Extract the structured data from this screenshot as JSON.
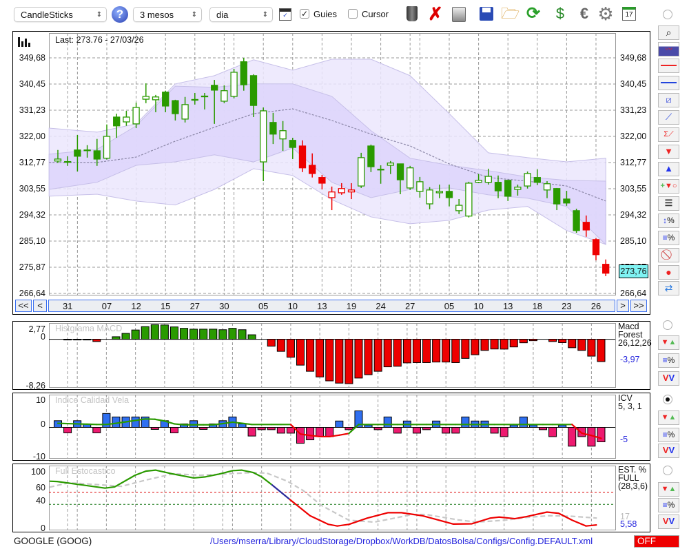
{
  "toolbar": {
    "chart_type": "CandleSticks",
    "help_label": "?",
    "period": "3 mesos",
    "interval": "dia",
    "guies_label": "Guies",
    "guies_checked": true,
    "cursor_label": "Cursor",
    "cursor_checked": false,
    "check_mark": "✓"
  },
  "colors": {
    "up": "#2a9a00",
    "red": "#ee0000",
    "band_outer": "#ebe6fd",
    "band_inner": "#ddd5fb",
    "icv_pos": "#2f6ff0",
    "icv_neg": "#ee1a70",
    "badge": "#7ff3f3",
    "off": "#ee0000",
    "path": "#2222dd"
  },
  "chart_data": {
    "type": "candlestick",
    "main": {
      "last_label": "Last: 273.76 - 27/03/26",
      "price_badge": "273,76",
      "y_tick_values": [
        349.68,
        340.45,
        331.23,
        322.0,
        312.77,
        303.55,
        294.32,
        285.1,
        275.87,
        266.64
      ],
      "y_ticks": [
        "349,68",
        "340,45",
        "331,23",
        "322,00",
        "312,77",
        "303,55",
        "294,32",
        "285,10",
        "275,87",
        "266,64"
      ],
      "ylim": [
        266.64,
        349.68
      ],
      "candles_ohlc": [
        [
          313.3,
          317.2,
          312.6,
          314.0,
          "g"
        ],
        [
          313.0,
          315.0,
          311.6,
          313.1,
          "g"
        ],
        [
          317.2,
          322.5,
          309.6,
          315.0,
          "g"
        ],
        [
          317.2,
          318.9,
          314.5,
          317.1,
          "g"
        ],
        [
          316.9,
          321.1,
          311.6,
          314.0,
          "g"
        ],
        [
          314.3,
          326.2,
          313.8,
          322.0,
          "g"
        ],
        [
          328.8,
          330.0,
          321.5,
          325.7,
          "g"
        ],
        [
          327.1,
          331.0,
          325.7,
          328.8,
          "g"
        ],
        [
          326.4,
          333.9,
          324.9,
          332.2,
          "g"
        ],
        [
          335.1,
          340.7,
          333.7,
          336.1,
          "g"
        ],
        [
          334.9,
          336.6,
          330.5,
          335.9,
          "g"
        ],
        [
          337.6,
          338.1,
          330.5,
          332.7,
          "g"
        ],
        [
          334.6,
          334.9,
          327.6,
          330.0,
          "g"
        ],
        [
          328.1,
          335.9,
          326.9,
          333.2,
          "g"
        ],
        [
          334.9,
          337.3,
          333.2,
          335.0,
          "g"
        ],
        [
          336.1,
          337.3,
          331.5,
          336.2,
          "g"
        ],
        [
          340.0,
          341.9,
          326.4,
          338.3,
          "g"
        ],
        [
          334.4,
          340.0,
          333.7,
          338.1,
          "g"
        ],
        [
          336.1,
          345.8,
          335.4,
          344.6,
          "g"
        ],
        [
          348.3,
          349.7,
          338.1,
          340.2,
          "g"
        ],
        [
          343.4,
          343.9,
          328.8,
          332.9,
          "g"
        ],
        [
          313.0,
          332.2,
          306.2,
          331.0,
          "g"
        ],
        [
          326.9,
          330.3,
          319.3,
          322.8,
          "g"
        ],
        [
          321.1,
          327.4,
          316.9,
          324.0,
          "g"
        ],
        [
          320.6,
          321.5,
          314.0,
          318.1,
          "g"
        ],
        [
          318.6,
          320.6,
          309.4,
          310.9,
          "r"
        ],
        [
          311.8,
          316.0,
          307.5,
          308.9,
          "r"
        ],
        [
          307.5,
          308.4,
          303.3,
          305.5,
          "r"
        ],
        [
          300.4,
          304.3,
          296.0,
          302.4,
          "r"
        ],
        [
          302.1,
          305.5,
          301.4,
          303.6,
          "r"
        ],
        [
          302.4,
          305.5,
          299.9,
          303.1,
          "r"
        ],
        [
          304.5,
          316.2,
          303.8,
          314.5,
          "g"
        ],
        [
          318.6,
          319.1,
          309.4,
          311.3,
          "g"
        ],
        [
          310.4,
          311.8,
          305.3,
          310.3,
          "g"
        ],
        [
          311.8,
          313.3,
          308.7,
          312.6,
          "g"
        ],
        [
          312.3,
          312.3,
          301.6,
          306.7,
          "g"
        ],
        [
          303.8,
          311.6,
          303.1,
          310.9,
          "g"
        ],
        [
          302.6,
          307.7,
          300.4,
          306.0,
          "g"
        ],
        [
          298.2,
          304.1,
          296.3,
          303.1,
          "g"
        ],
        [
          302.1,
          305.0,
          300.2,
          302.6,
          "g"
        ],
        [
          302.6,
          305.0,
          297.3,
          300.4,
          "g"
        ],
        [
          295.8,
          299.9,
          294.6,
          297.7,
          "g"
        ],
        [
          293.9,
          306.0,
          293.4,
          305.5,
          "g"
        ],
        [
          305.8,
          308.7,
          305.5,
          306.5,
          "g"
        ],
        [
          305.8,
          310.6,
          305.0,
          307.9,
          "g"
        ],
        [
          305.8,
          308.2,
          300.2,
          302.8,
          "g"
        ],
        [
          306.5,
          306.5,
          299.2,
          300.9,
          "g"
        ],
        [
          303.3,
          305.0,
          301.1,
          304.1,
          "g"
        ],
        [
          304.5,
          309.6,
          303.6,
          308.9,
          "g"
        ],
        [
          307.5,
          310.4,
          304.8,
          305.8,
          "g"
        ],
        [
          303.1,
          306.2,
          300.2,
          305.3,
          "g"
        ],
        [
          303.6,
          303.8,
          296.0,
          298.2,
          "g"
        ],
        [
          299.9,
          302.8,
          297.5,
          298.5,
          "g"
        ],
        [
          295.8,
          296.5,
          288.0,
          288.8,
          "g"
        ],
        [
          291.7,
          294.1,
          286.6,
          289.0,
          "r"
        ],
        [
          285.6,
          286.1,
          278.3,
          280.3,
          "r"
        ],
        [
          276.9,
          278.6,
          272.7,
          273.76,
          "r"
        ]
      ],
      "bands": {
        "index": [
          -0.9,
          4,
          8,
          12,
          16,
          20,
          24,
          28,
          32,
          36,
          40,
          44,
          48,
          52,
          56
        ],
        "upper2": [
          324.9,
          323.5,
          326.4,
          340.5,
          343.4,
          349.0,
          345.3,
          349.2,
          349.2,
          343.4,
          330.0,
          316.2,
          314.5,
          313.0,
          314.3
        ],
        "upper1": [
          315.7,
          317.4,
          325.7,
          339.7,
          339.3,
          340.5,
          340.5,
          336.1,
          324.0,
          314.3,
          311.8,
          309.9,
          307.7,
          306.5,
          306.2
        ],
        "mid": [
          312.8,
          312.8,
          314.7,
          320.3,
          325.2,
          330.0,
          331.7,
          327.6,
          322.8,
          318.6,
          312.3,
          307.5,
          306.2,
          304.5,
          299.2
        ],
        "lower1": [
          303.3,
          305.8,
          311.8,
          313.0,
          315.5,
          313.0,
          317.9,
          305.8,
          300.4,
          303.3,
          303.8,
          301.4,
          300.2,
          297.3,
          283.9
        ],
        "lower2": [
          300.9,
          301.6,
          299.2,
          297.8,
          303.3,
          310.6,
          308.2,
          299.7,
          293.6,
          291.2,
          292.4,
          296.0,
          297.3,
          288.8,
          283.9
        ]
      }
    },
    "grid_index": [
      1,
      2,
      5,
      8,
      11,
      14,
      17,
      18,
      21,
      24,
      27,
      30,
      33,
      36,
      37,
      40,
      43,
      46,
      49,
      52,
      55
    ],
    "dates": [
      {
        "i": 1,
        "label": "31"
      },
      {
        "i": 5,
        "label": "07"
      },
      {
        "i": 8,
        "label": "12"
      },
      {
        "i": 11,
        "label": "15"
      },
      {
        "i": 14,
        "label": "27"
      },
      {
        "i": 17,
        "label": "30"
      },
      {
        "i": 21,
        "label": "05"
      },
      {
        "i": 24,
        "label": "10"
      },
      {
        "i": 27,
        "label": "13"
      },
      {
        "i": 30,
        "label": "19"
      },
      {
        "i": 33,
        "label": "24"
      },
      {
        "i": 36,
        "label": "27"
      },
      {
        "i": 40,
        "label": "05"
      },
      {
        "i": 43,
        "label": "10"
      },
      {
        "i": 46,
        "label": "13"
      },
      {
        "i": 49,
        "label": "18"
      },
      {
        "i": 52,
        "label": "23"
      },
      {
        "i": 55,
        "label": "26"
      }
    ],
    "nav": {
      "first": "<<",
      "prev": "<",
      "next": ">",
      "last": ">>"
    },
    "macd": {
      "title": "Histgrama MACD",
      "ylim": [
        -8.26,
        2.77
      ],
      "y_ticks": [
        "2,77",
        "0",
        "-8,26"
      ],
      "name": "Macd",
      "name2": "Forest",
      "params": "26,12,26",
      "last_value": "-3,97",
      "values": [
        0,
        -0.1,
        -0.1,
        -0.1,
        -0.4,
        0,
        0.45,
        1.05,
        1.65,
        2.25,
        2.6,
        2.55,
        2.2,
        1.95,
        1.8,
        1.8,
        1.8,
        1.7,
        1.95,
        1.7,
        0.8,
        0,
        -1.23,
        -2.15,
        -3.2,
        -4.6,
        -5.7,
        -6.7,
        -7.4,
        -7.8,
        -7.9,
        -6.9,
        -6.3,
        -5.7,
        -4.9,
        -4.8,
        -4.2,
        -4.15,
        -4.15,
        -4.05,
        -4.05,
        -4.15,
        -3.4,
        -2.75,
        -1.98,
        -1.73,
        -1.75,
        -1.36,
        -0.62,
        -0.25,
        0,
        -0.4,
        -0.6,
        -1.5,
        -1.98,
        -3.0,
        -3.97
      ]
    },
    "icv": {
      "title": "Indice Calidad Vela",
      "ylim": [
        -10,
        10
      ],
      "y_ticks": [
        "10",
        "0",
        "-10"
      ],
      "name": "ICV",
      "params": "5, 3, 1",
      "last_value": "-5",
      "bars": [
        2.3,
        -1.9,
        2.3,
        1.2,
        -1.9,
        4.8,
        3.6,
        3.6,
        3.6,
        3.6,
        -0.7,
        2.3,
        -1.9,
        1.2,
        2.3,
        -0.7,
        1.2,
        2.3,
        3.6,
        1.2,
        -3.0,
        -0.8,
        -0.8,
        -2.0,
        -2.0,
        -5.5,
        -4.3,
        -3.2,
        -3.2,
        2.2,
        -0.8,
        5.7,
        0.8,
        -0.8,
        3.6,
        -2.0,
        2.2,
        -2.0,
        -0.8,
        2.2,
        -2.0,
        -2.0,
        3.6,
        2.2,
        2.2,
        -2.0,
        -3.2,
        0.8,
        3.6,
        0.8,
        -0.8,
        -3.2,
        0.8,
        -6.5,
        -3.2,
        -6.5,
        -5
      ],
      "line": [
        1.4,
        1.3,
        1.2,
        1.1,
        1.0,
        1.0,
        1.4,
        1.9,
        2.4,
        2.9,
        2.8,
        2.2,
        1.2,
        0.9,
        0.9,
        0.9,
        0.9,
        1.3,
        1.8,
        1.4,
        1.0,
        1.0,
        1.0,
        1.0,
        1.0,
        -2.3,
        -2.8,
        -3.2,
        -3.2,
        -2.7,
        -2.1,
        1.0,
        1.0,
        1.0,
        1.0,
        1.0,
        1.0,
        1.0,
        1.0,
        1.0,
        1.0,
        1.0,
        1.0,
        1.0,
        1.0,
        1.0,
        1.0,
        1.0,
        1.0,
        1.0,
        1.0,
        1.0,
        1.0,
        1.0,
        -2.0,
        -2.8,
        -3.8
      ]
    },
    "stoch": {
      "title": "Full Estocastico",
      "ylim": [
        0,
        100
      ],
      "y_tick_values": [
        100,
        60,
        40,
        0
      ],
      "y_ticks": [
        "100",
        "60",
        "40",
        "0"
      ],
      "overbought": 60,
      "oversold": 40,
      "name": "EST. %",
      "name2": "FULL",
      "params": "(28,3,6)",
      "signal_value": "17",
      "last_value": "5,58",
      "main_segments": [
        {
          "color": "#2a9a00",
          "points": [
            [
              -0.85,
              78.5
            ],
            [
              -0.07,
              78
            ],
            [
              1.97,
              73.5
            ],
            [
              4.86,
              67
            ],
            [
              5.85,
              69
            ],
            [
              7.96,
              88.5
            ],
            [
              9.08,
              95.4
            ],
            [
              10.07,
              97
            ],
            [
              11.9,
              90.5
            ],
            [
              14.01,
              84
            ],
            [
              15.21,
              85.8
            ],
            [
              16.62,
              90.5
            ],
            [
              18.03,
              96.2
            ],
            [
              18.94,
              97
            ],
            [
              20.14,
              93
            ],
            [
              20.99,
              86
            ],
            [
              22.04,
              72.8
            ]
          ]
        },
        {
          "color": "#2a2a9a",
          "points": [
            [
              22.04,
              72.8
            ],
            [
              23.87,
              48.6
            ]
          ]
        },
        {
          "color": "#ee0000",
          "points": [
            [
              23.87,
              48.6
            ],
            [
              25.99,
              21
            ],
            [
              27.89,
              6.5
            ],
            [
              28.8,
              3.8
            ],
            [
              30.0,
              6.5
            ],
            [
              31.9,
              17
            ],
            [
              34.01,
              26
            ],
            [
              35.42,
              26
            ],
            [
              37.54,
              21
            ],
            [
              38.94,
              15
            ],
            [
              40.77,
              7
            ],
            [
              42.68,
              7.5
            ],
            [
              44.58,
              17
            ],
            [
              45.49,
              18.7
            ],
            [
              47.11,
              16
            ],
            [
              48.31,
              19.5
            ],
            [
              50.42,
              27
            ],
            [
              51.62,
              25
            ],
            [
              53.03,
              13.4
            ],
            [
              54.44,
              3.8
            ],
            [
              55.56,
              5.58
            ]
          ]
        }
      ],
      "signal": [
        [
          -0.85,
          68.6
        ],
        [
          1.13,
          76
        ],
        [
          3.94,
          73
        ],
        [
          6.55,
          70
        ],
        [
          9.08,
          80.5
        ],
        [
          11.9,
          91
        ],
        [
          14.72,
          88.5
        ],
        [
          17.54,
          91
        ],
        [
          20.14,
          93
        ],
        [
          21.55,
          92
        ],
        [
          23.66,
          78.5
        ],
        [
          25.28,
          63
        ],
        [
          27.18,
          38
        ],
        [
          30.0,
          13.4
        ],
        [
          32.61,
          10.3
        ],
        [
          34.72,
          17
        ],
        [
          36.55,
          23
        ],
        [
          37.96,
          23
        ],
        [
          41.27,
          14
        ],
        [
          43.17,
          10.3
        ],
        [
          45.99,
          13.4
        ],
        [
          48.31,
          18
        ],
        [
          50.63,
          21
        ],
        [
          53.03,
          20
        ],
        [
          55.56,
          17
        ]
      ]
    }
  },
  "footer": {
    "symbol": "GOOGLE (GOOG)",
    "path": "/Users/mserra/Library/CloudStorage/Dropbox/WorkDB/DatosBolsa/Configs/Config.DEFAULT.xml",
    "status": "OFF"
  }
}
